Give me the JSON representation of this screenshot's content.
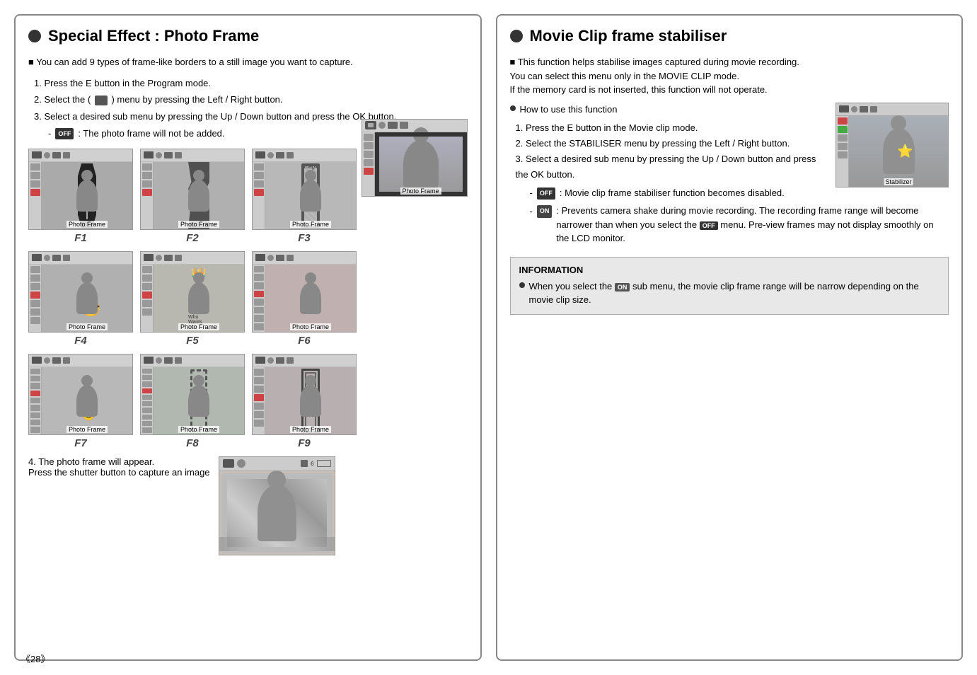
{
  "left": {
    "title": "Special Effect : Photo Frame",
    "intro": "You can add 9 types of frame-like borders to a still image you want to capture.",
    "steps": [
      "1. Press the E button in the Program mode.",
      "2. Select the (    ) menu by pressing the Left / Right button.",
      "3. Select a desired sub menu by pressing the Up / Down button and press the OK button."
    ],
    "substep_off": ": The photo frame will not be added.",
    "frames": [
      {
        "id": "f1",
        "label": "Photo Frame",
        "number": "F1"
      },
      {
        "id": "f2",
        "label": "Photo Frame",
        "number": "F2"
      },
      {
        "id": "f3",
        "label": "Photo Frame",
        "number": "F3"
      },
      {
        "id": "f4",
        "label": "Photo Frame",
        "number": "F4"
      },
      {
        "id": "f5",
        "label": "Photo Frame",
        "number": "F5"
      },
      {
        "id": "f6",
        "label": "Photo Frame",
        "number": "F6"
      },
      {
        "id": "f7",
        "label": "Photo Frame",
        "number": "F7"
      },
      {
        "id": "f8",
        "label": "8 Photo Frame",
        "number": "F8"
      },
      {
        "id": "f9",
        "label": "Photo Frame",
        "number": "F9"
      }
    ],
    "step4": "4. The photo frame will appear.",
    "step4b": "Press the shutter button to capture an image"
  },
  "right": {
    "title": "Movie Clip frame stabiliser",
    "intro1": "This function helps stabilise images captured during movie recording.",
    "intro2": "You can select this menu only in the MOVIE CLIP mode.",
    "intro3": "If the memory card is not inserted, this function will not operate.",
    "how_to": "How to use this function",
    "steps": [
      "1. Press the E button in the Movie clip mode.",
      "2. Select the STABILISER menu by pressing the Left / Right button.",
      "3. Select a desired sub menu by pressing the Up / Down button and press the OK button."
    ],
    "substep_off": ": Movie clip frame stabiliser function becomes disabled.",
    "substep_on": ": Prevents camera shake during movie recording. The recording frame range will become narrower than when you select the      menu. Pre-view frames may not display smoothly on the LCD monitor.",
    "stabilizer_label": "Stabilizer",
    "info_title": "INFORMATION",
    "info_text": "When you select the    sub menu, the movie clip frame range will be narrow depending on the movie clip size."
  },
  "page_number": "《28》"
}
